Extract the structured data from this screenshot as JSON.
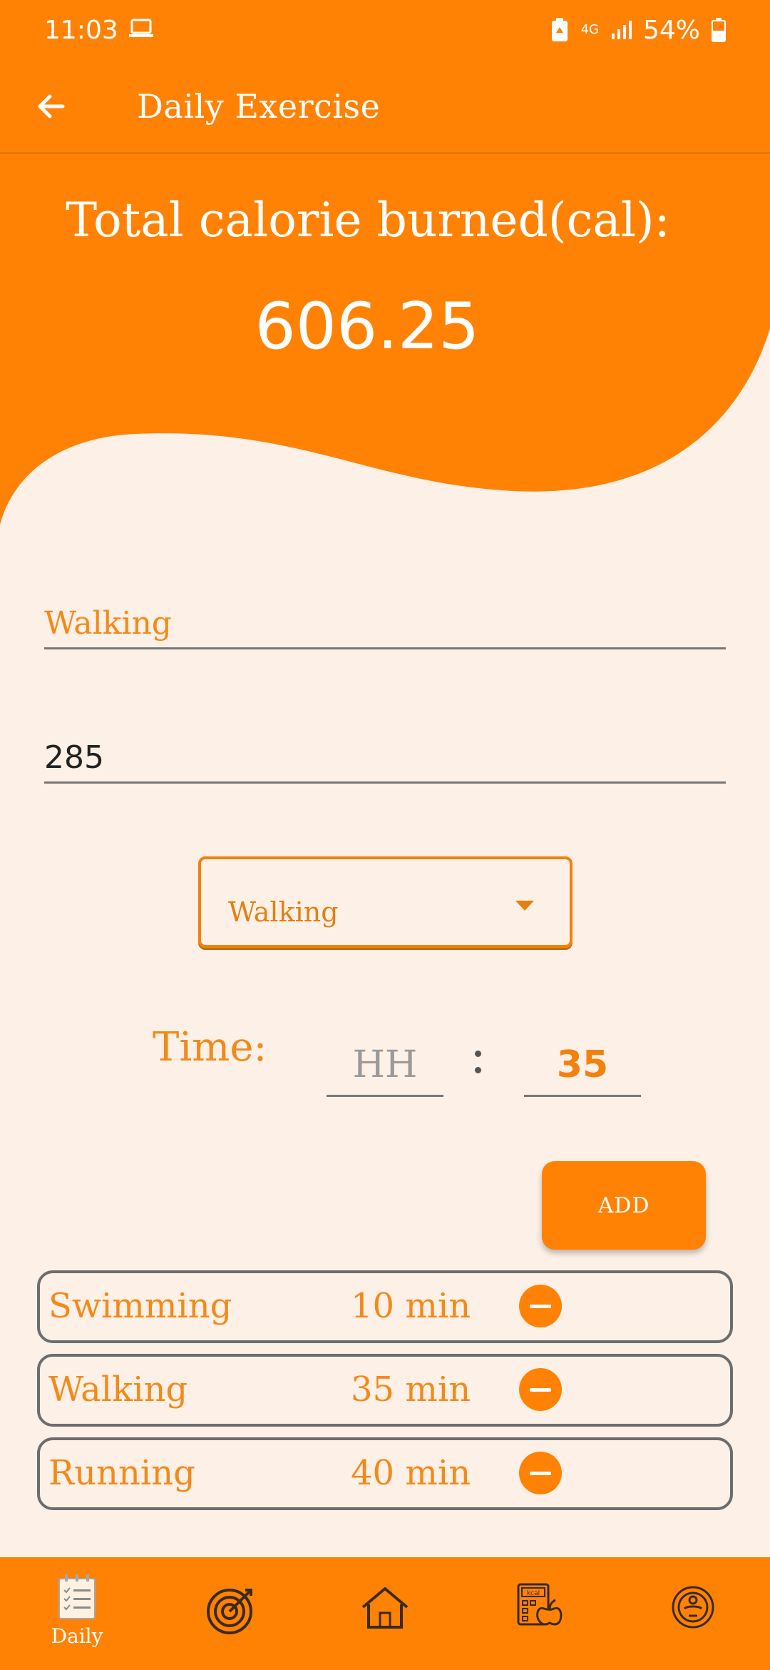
{
  "status_bar": {
    "time": "11:03",
    "network": "4G",
    "battery": "54%"
  },
  "app_bar": {
    "title": "Daily Exercise"
  },
  "summary": {
    "label": "Total calorie burned(cal):",
    "value": "606.25"
  },
  "form": {
    "exercise_name": "Walking",
    "calories": "285",
    "dropdown_selected": "Walking",
    "time_label": "Time:",
    "hours_placeholder": "HH",
    "minutes": "35",
    "add_label": "ADD"
  },
  "exercises": [
    {
      "name": "Swimming",
      "duration": "10 min"
    },
    {
      "name": "Walking",
      "duration": "35 min"
    },
    {
      "name": "Running",
      "duration": "40 min"
    }
  ],
  "bottom_nav": {
    "items": [
      {
        "icon": "clipboard-checklist-icon",
        "label": "Daily"
      },
      {
        "icon": "target-icon"
      },
      {
        "icon": "home-icon"
      },
      {
        "icon": "kcal-calculator-icon"
      },
      {
        "icon": "scale-icon"
      }
    ]
  },
  "colors": {
    "primary": "#FF8205",
    "accent_text": "#F28A1A",
    "background": "#FDF0E6"
  }
}
